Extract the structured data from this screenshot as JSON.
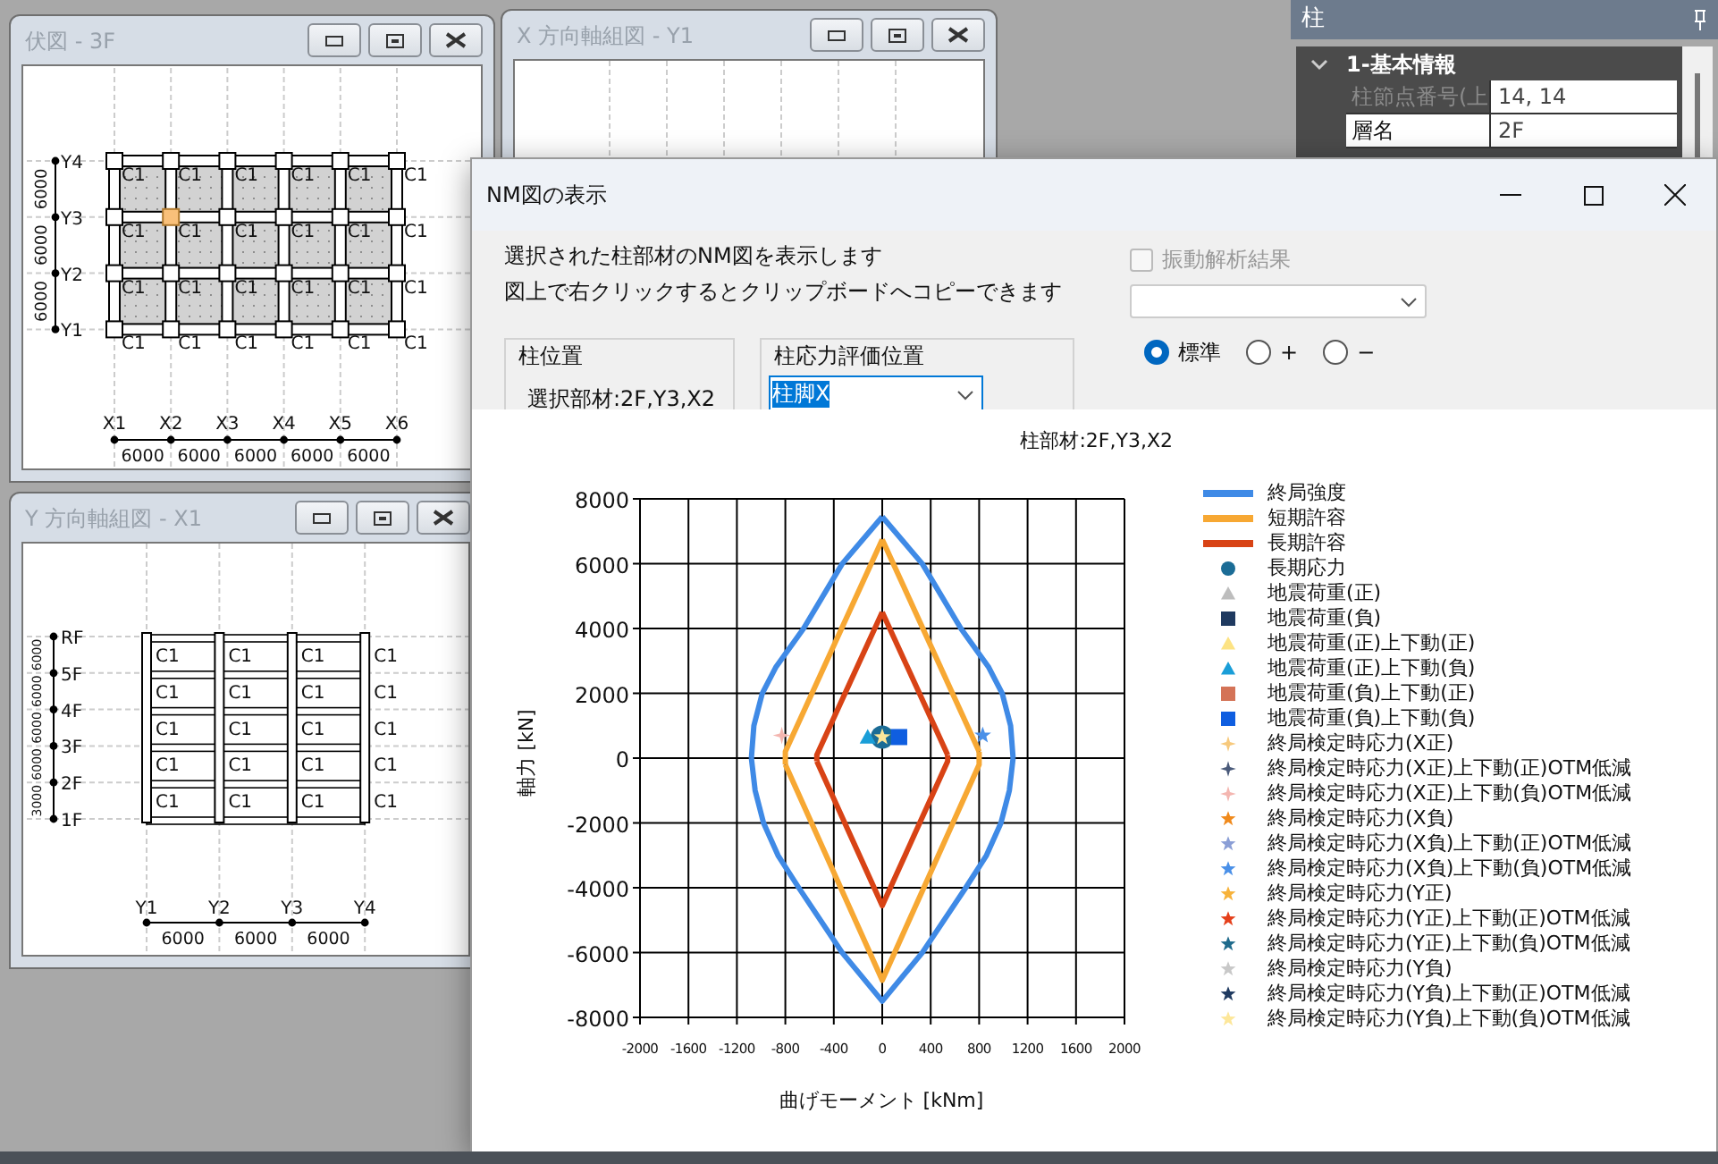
{
  "desktop": {
    "plan_window": {
      "title": "伏図 - 3F",
      "x_axes": [
        "X1",
        "X2",
        "X3",
        "X4",
        "X5",
        "X6"
      ],
      "y_axes": [
        "Y4",
        "Y3",
        "Y2",
        "Y1"
      ],
      "x_spans": [
        "6000",
        "6000",
        "6000",
        "6000",
        "6000"
      ],
      "y_spans": [
        "6000",
        "6000",
        "6000"
      ],
      "column_rows": [
        [
          {
            "label": "C1",
            "selected": false
          },
          {
            "label": "C1",
            "selected": false
          },
          {
            "label": "C1",
            "selected": false
          },
          {
            "label": "C1",
            "selected": false
          },
          {
            "label": "C1",
            "selected": false
          },
          {
            "label": "C1",
            "selected": false
          }
        ],
        [
          {
            "label": "C1",
            "selected": false
          },
          {
            "label": "C1",
            "selected": true
          },
          {
            "label": "C1",
            "selected": false
          },
          {
            "label": "C1",
            "selected": false
          },
          {
            "label": "C1",
            "selected": false
          },
          {
            "label": "C1",
            "selected": false
          }
        ],
        [
          {
            "label": "C1",
            "selected": false
          },
          {
            "label": "C1",
            "selected": false
          },
          {
            "label": "C1",
            "selected": false
          },
          {
            "label": "C1",
            "selected": false
          },
          {
            "label": "C1",
            "selected": false
          },
          {
            "label": "C1",
            "selected": false
          }
        ],
        [
          {
            "label": "C1",
            "selected": false
          },
          {
            "label": "C1",
            "selected": false
          },
          {
            "label": "C1",
            "selected": false
          },
          {
            "label": "C1",
            "selected": false
          },
          {
            "label": "C1",
            "selected": false
          },
          {
            "label": "C1",
            "selected": false
          }
        ]
      ]
    },
    "x_frame_window": {
      "title": "X 方向軸組図 - Y1"
    },
    "y_frame_window": {
      "title": "Y 方向軸組図 - X1",
      "axes": [
        "Y1",
        "Y2",
        "Y3",
        "Y4"
      ],
      "spans": [
        "6000",
        "6000",
        "6000"
      ],
      "floors": [
        "RF",
        "5F",
        "4F",
        "3F",
        "2F",
        "1F"
      ],
      "storey_heights": [
        "6000",
        "6000",
        "6000",
        "6000",
        "3000"
      ],
      "column_rows": [
        [
          "C1",
          "C1",
          "C1",
          "C1"
        ],
        [
          "C1",
          "C1",
          "C1",
          "C1"
        ],
        [
          "C1",
          "C1",
          "C1",
          "C1"
        ],
        [
          "C1",
          "C1",
          "C1",
          "C1"
        ],
        [
          "C1",
          "C1",
          "C1",
          "C1"
        ]
      ]
    }
  },
  "property_panel": {
    "title": "柱",
    "category": {
      "label": "1-基本情報",
      "expanded": true
    },
    "rows": [
      {
        "name": "柱節点番号(上",
        "value": "14, 14",
        "disabled": true
      },
      {
        "name": "層名",
        "value": "2F",
        "disabled": false
      }
    ]
  },
  "dialog": {
    "title": "NM図の表示",
    "description": [
      "選択された柱部材のNM図を表示します",
      "図上で右クリックするとクリップボードへコピーできます"
    ],
    "position_group": {
      "label": "柱位置",
      "text": "選択部材:2F,Y3,X2"
    },
    "evaluation_group": {
      "label": "柱応力評価位置",
      "value": "柱脚X"
    },
    "vibration_checkbox": {
      "label": "振動解析結果",
      "checked": false,
      "disabled": true
    },
    "vibration_select": {
      "disabled": true
    },
    "radios": [
      {
        "label": "標準",
        "selected": true
      },
      {
        "label": "+",
        "selected": false
      },
      {
        "label": "−",
        "selected": false
      }
    ],
    "chart_data": {
      "type": "line",
      "title": "柱部材:2F,Y3,X2",
      "xlabel": "曲げモーメント [kNm]",
      "ylabel": "軸力 [kN]",
      "xlim": [
        -2000,
        2000
      ],
      "ylim": [
        -8000,
        8000
      ],
      "xticks": [
        -2000,
        -1600,
        -1200,
        -800,
        -400,
        0,
        400,
        800,
        1200,
        1600,
        2000
      ],
      "yticks": [
        -8000,
        -6000,
        -4000,
        -2000,
        0,
        2000,
        4000,
        6000,
        8000
      ],
      "series": [
        {
          "name": "終局強度",
          "color": "#3f8ae6",
          "marker": "none",
          "x": [
            0,
            -330,
            -650,
            -880,
            -990,
            -1060,
            -1080,
            -1050,
            -980,
            -860,
            -690,
            -330,
            0,
            330,
            690,
            860,
            980,
            1050,
            1080,
            1060,
            990,
            880,
            650,
            330,
            0
          ],
          "values": [
            7450,
            6000,
            4000,
            2800,
            2000,
            1000,
            0,
            -1000,
            -2000,
            -3000,
            -4000,
            -6000,
            -7500,
            -6000,
            -4000,
            -3000,
            -2000,
            -1000,
            0,
            1000,
            2000,
            2800,
            4000,
            6000,
            7450
          ]
        },
        {
          "name": "短期許容",
          "color": "#f7a833",
          "marker": "none",
          "x": [
            0,
            -800,
            -800,
            0,
            800,
            800,
            0
          ],
          "values": [
            6750,
            200,
            -200,
            -6850,
            -200,
            200,
            6750
          ]
        },
        {
          "name": "長期許容",
          "color": "#d84315",
          "marker": "none",
          "x": [
            0,
            -540,
            -540,
            0,
            540,
            540,
            0
          ],
          "values": [
            4500,
            100,
            -100,
            -4550,
            -100,
            100,
            4500
          ]
        },
        {
          "name": "長期応力",
          "color": "#1b6c96",
          "marker": "circle",
          "x": [
            0
          ],
          "values": [
            650
          ]
        },
        {
          "name": "地震荷重(正)",
          "color": "#bdbdbd",
          "marker": "triangle"
        },
        {
          "name": "地震荷重(負)",
          "color": "#1f3a60",
          "marker": "square"
        },
        {
          "name": "地震荷重(正)上下動(正)",
          "color": "#fde383",
          "marker": "triangle"
        },
        {
          "name": "地震荷重(正)上下動(負)",
          "color": "#1a9ed8",
          "marker": "triangle",
          "x": [
            -120
          ],
          "values": [
            650
          ]
        },
        {
          "name": "地震荷重(負)上下動(正)",
          "color": "#d47357",
          "marker": "square"
        },
        {
          "name": "地震荷重(負)上下動(負)",
          "color": "#0f5ee0",
          "marker": "square",
          "x": [
            140
          ],
          "values": [
            650
          ]
        },
        {
          "name": "終局検定時応力(X正)",
          "color": "#f7c97c",
          "marker": "cross"
        },
        {
          "name": "終局検定時応力(X正)上下動(正)OTM低減",
          "color": "#4a5a7a",
          "marker": "cross"
        },
        {
          "name": "終局検定時応力(X正)上下動(負)OTM低減",
          "color": "#f4b6b0",
          "marker": "cross",
          "x": [
            -830
          ],
          "values": [
            700
          ]
        },
        {
          "name": "終局検定時応力(X負)",
          "color": "#f08a1c",
          "marker": "star"
        },
        {
          "name": "終局検定時応力(X負)上下動(正)OTM低減",
          "color": "#8a9ed6",
          "marker": "star"
        },
        {
          "name": "終局検定時応力(X負)上下動(負)OTM低減",
          "color": "#4a90e8",
          "marker": "star",
          "x": [
            830
          ],
          "values": [
            700
          ]
        },
        {
          "name": "終局検定時応力(Y正)",
          "color": "#f7b23a",
          "marker": "star"
        },
        {
          "name": "終局検定時応力(Y正)上下動(正)OTM低減",
          "color": "#e5401b",
          "marker": "star"
        },
        {
          "name": "終局検定時応力(Y正)上下動(負)OTM低減",
          "color": "#1f6b8c",
          "marker": "star"
        },
        {
          "name": "終局検定時応力(Y負)",
          "color": "#c8c8c8",
          "marker": "star"
        },
        {
          "name": "終局検定時応力(Y負)上下動(正)OTM低減",
          "color": "#1f3a60",
          "marker": "star"
        },
        {
          "name": "終局検定時応力(Y負)上下動(負)OTM低減",
          "color": "#fde79a",
          "marker": "star",
          "x": [
            0
          ],
          "values": [
            650
          ]
        }
      ],
      "grid": true
    }
  }
}
